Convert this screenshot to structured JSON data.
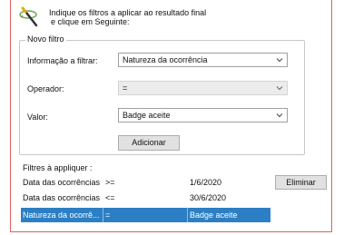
{
  "instructions": [
    "Indique os filtros a aplicar ao resultado final",
    "e clique em Seguinte:"
  ],
  "new_filter": {
    "legend": "Novo filtro",
    "info_label": "Informação a filtrar:",
    "info_value": "Natureza da ocorrência",
    "operator_label": "Operador:",
    "operator_value": "=",
    "value_label": "Valor:",
    "value_value": "Badge aceite",
    "add_button": "Adicionar"
  },
  "applied": {
    "title": "Filtres à appliquer :",
    "rows": [
      {
        "field": "Data das ocorrências",
        "op": ">=",
        "value": "1/6/2020"
      },
      {
        "field": "Data das ocorrências",
        "op": "<=",
        "value": "30/6/2020"
      },
      {
        "field": "Natureza da ocorrê...",
        "op": "=",
        "value": "Badge aceite"
      }
    ],
    "delete_button": "Eliminar"
  },
  "colors": {
    "selection": "#2c7fc4",
    "frame": "#e06060"
  },
  "icons": [
    "magic-wand-icon",
    "chevron-down-icon"
  ]
}
